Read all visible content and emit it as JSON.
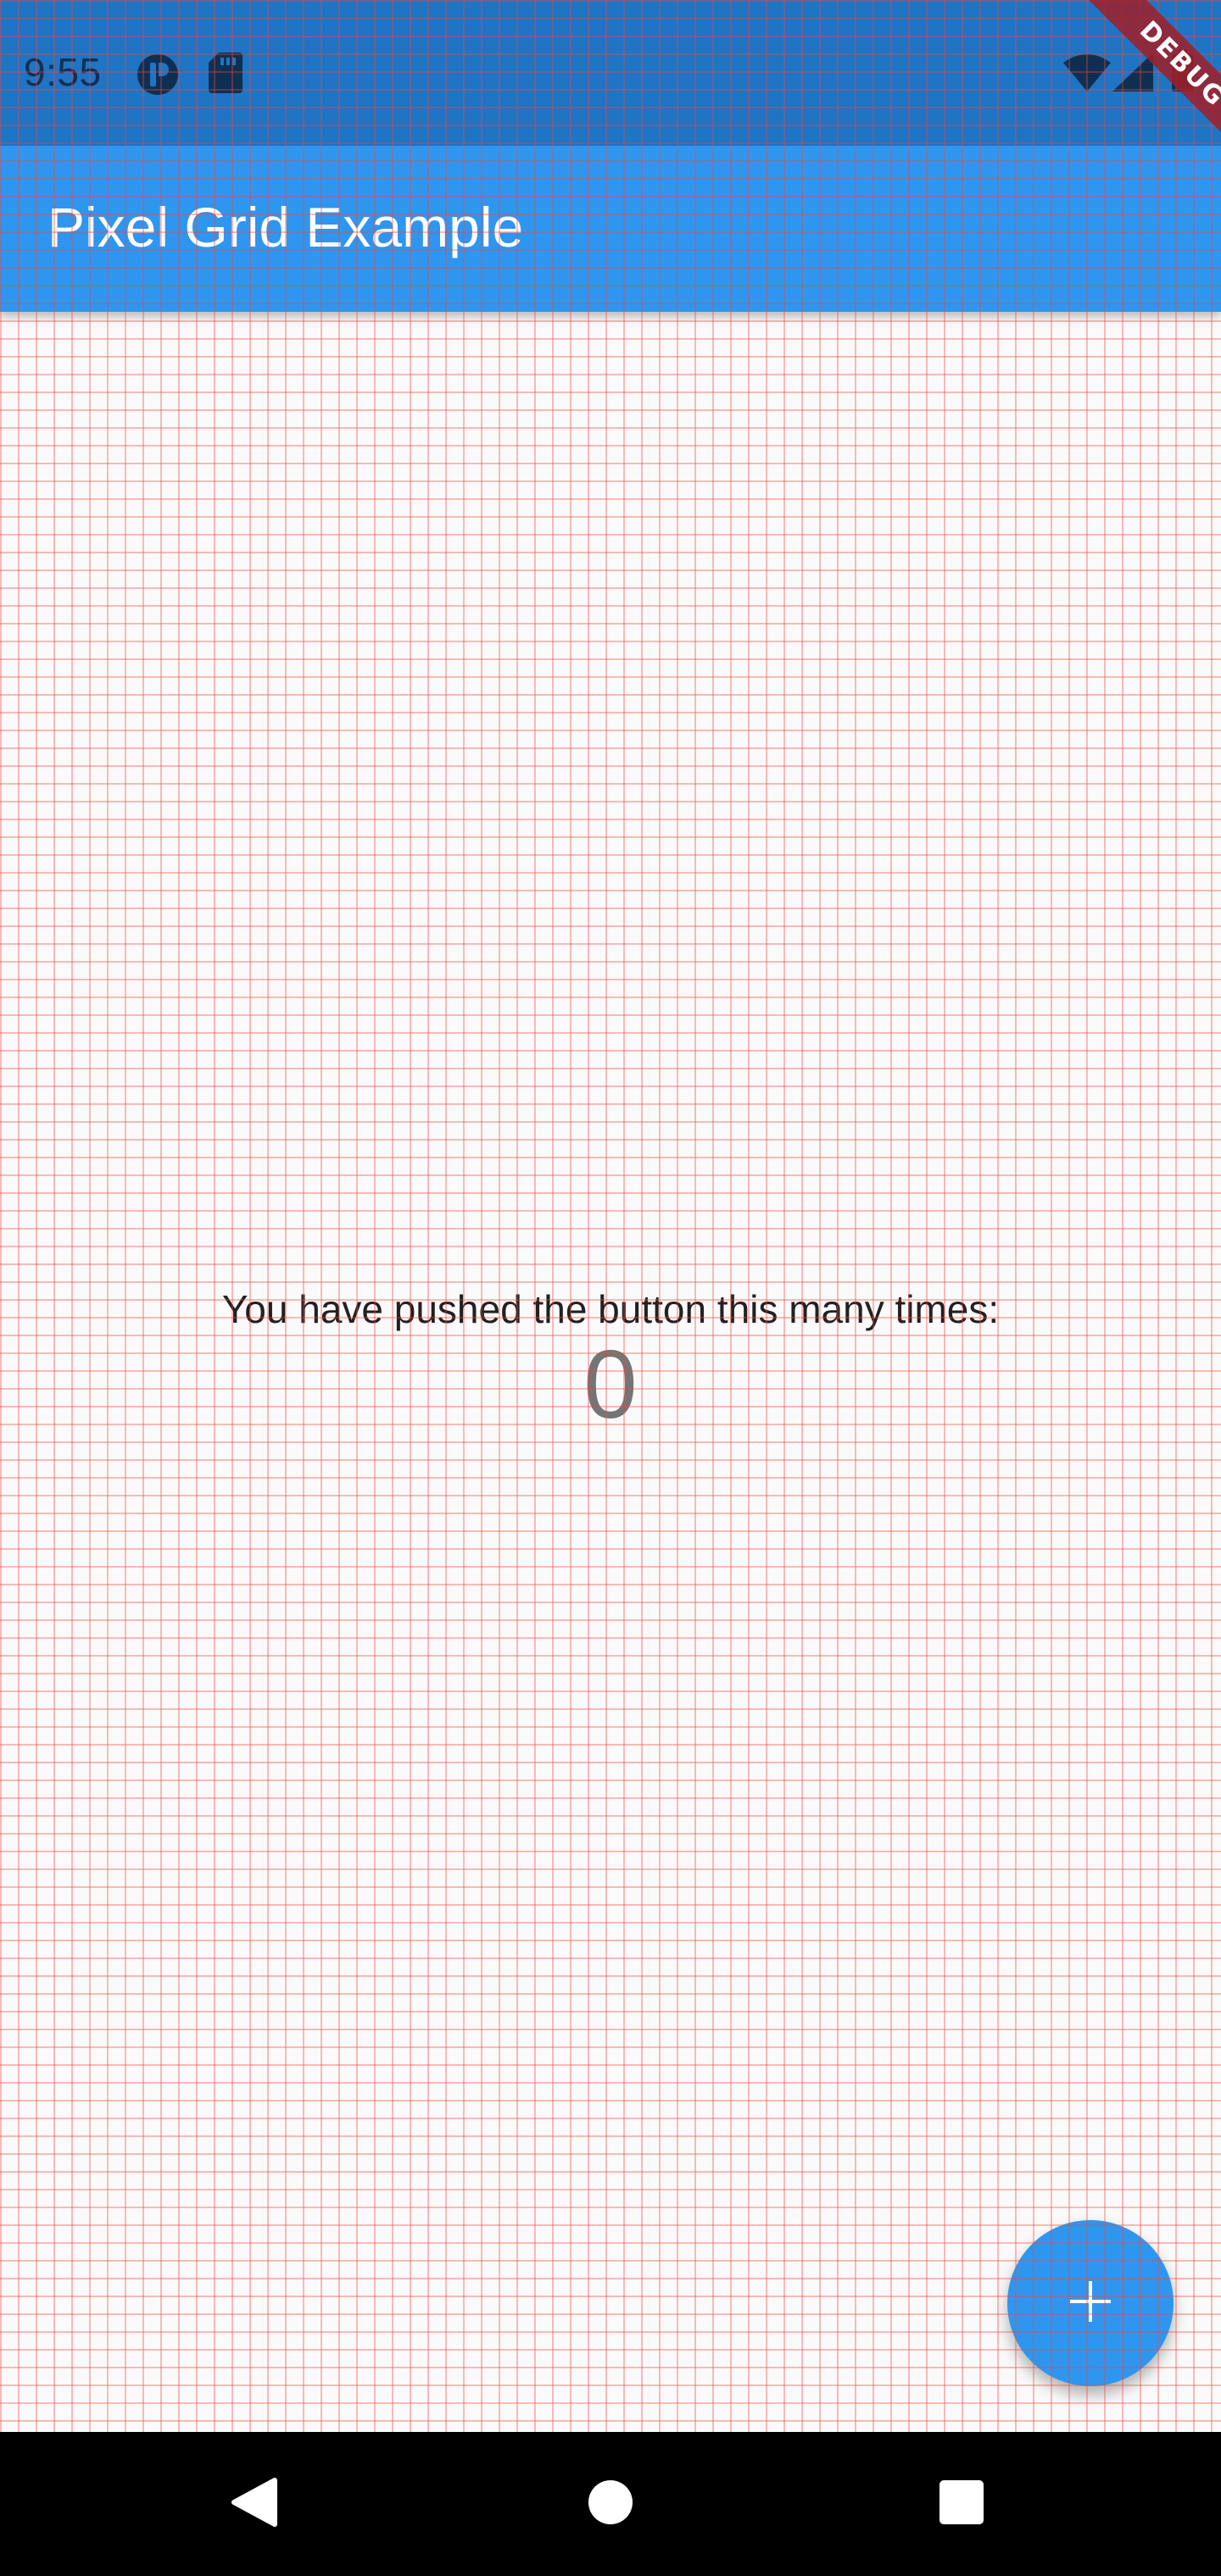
{
  "status_bar": {
    "time": "9:55",
    "left_icons": [
      "record-icon",
      "sd-card-icon"
    ],
    "right_icons": [
      "wifi-icon",
      "signal-icon",
      "battery-icon"
    ]
  },
  "app_bar": {
    "title": "Pixel Grid Example"
  },
  "main": {
    "counter_label": "You have pushed the button this many times:",
    "counter_value": "0"
  },
  "fab": {
    "icon": "plus-icon"
  },
  "debug_banner": {
    "label": "DEBUG"
  },
  "navigation": {
    "buttons": [
      "back-icon",
      "home-icon",
      "recents-icon"
    ]
  },
  "colors": {
    "status_bar": "#1f74c4",
    "app_bar": "#2f96ef",
    "fab": "#2f96ef",
    "grid_line": "#f44336",
    "nav_bar": "#000000"
  }
}
